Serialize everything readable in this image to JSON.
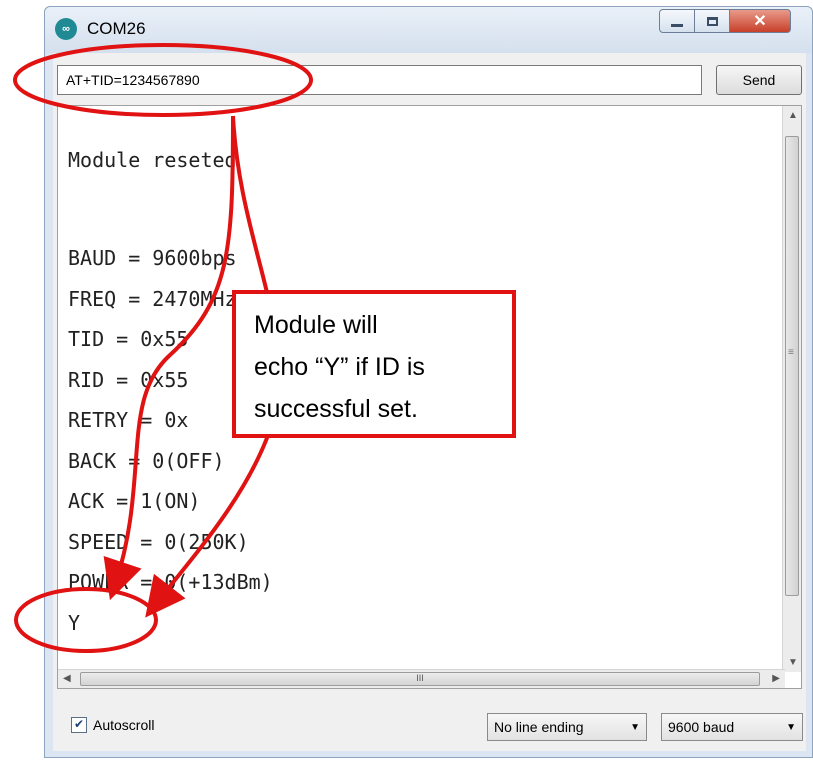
{
  "window": {
    "title": "COM26",
    "app_icon_glyph": "∞"
  },
  "toolbar": {
    "command_value": "AT+TID=1234567890",
    "send_label": "Send"
  },
  "serial_output": [
    "Module reseted",
    "",
    "BAUD = 9600bps",
    "FREQ = 2470MHz",
    "TID = 0x55",
    "RID = 0x55",
    "RETRY = 0x",
    "BACK = 0(OFF)",
    "ACK = 1(ON)",
    "SPEED = 0(250K)",
    "POWER = 0(+13dBm)",
    "Y"
  ],
  "scroll": {
    "h_thumb_glyph": "III"
  },
  "bottom": {
    "autoscroll_label": "Autoscroll",
    "autoscroll_checked": true,
    "line_ending": "No line ending",
    "baud": "9600 baud"
  },
  "annotation": {
    "callout_lines": [
      "Module will",
      "echo “Y” if ID is",
      "successful set."
    ],
    "color": "#e01212"
  }
}
